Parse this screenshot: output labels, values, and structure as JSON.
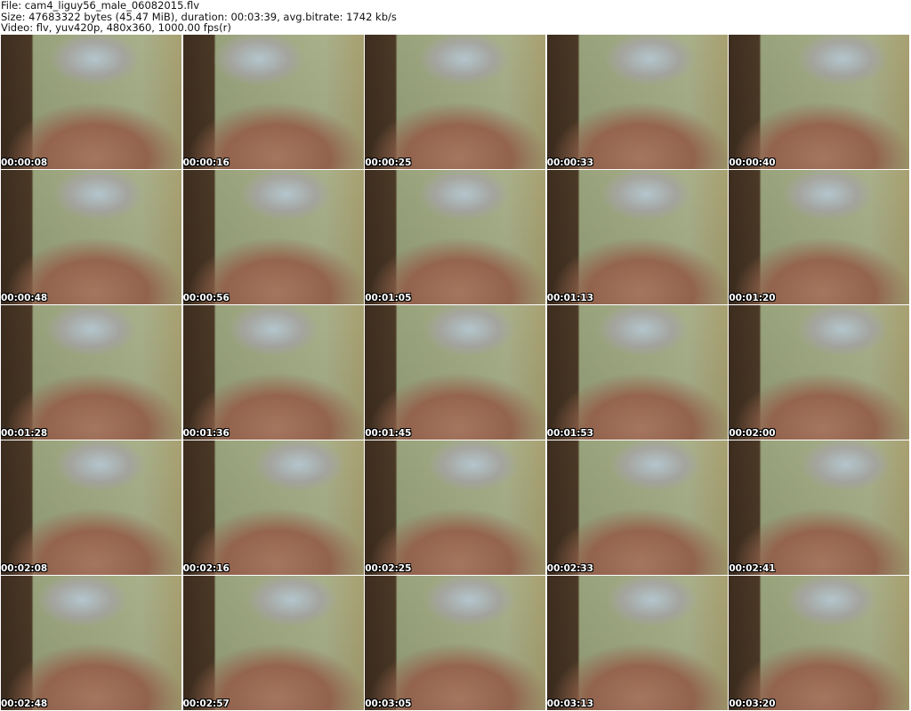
{
  "header": {
    "file_line": "File: cam4_liguy56_male_06082015.flv",
    "size_line": "Size: 47683322 bytes (45.47 MiB), duration: 00:03:39, avg.bitrate: 1742 kb/s",
    "video_line": "Video: flv, yuv420p, 480x360, 1000.00 fps(r)"
  },
  "thumbnails": [
    {
      "timestamp": "00:00:08"
    },
    {
      "timestamp": "00:00:16"
    },
    {
      "timestamp": "00:00:25"
    },
    {
      "timestamp": "00:00:33"
    },
    {
      "timestamp": "00:00:40"
    },
    {
      "timestamp": "00:00:48"
    },
    {
      "timestamp": "00:00:56"
    },
    {
      "timestamp": "00:01:05"
    },
    {
      "timestamp": "00:01:13"
    },
    {
      "timestamp": "00:01:20"
    },
    {
      "timestamp": "00:01:28"
    },
    {
      "timestamp": "00:01:36"
    },
    {
      "timestamp": "00:01:45"
    },
    {
      "timestamp": "00:01:53"
    },
    {
      "timestamp": "00:02:00"
    },
    {
      "timestamp": "00:02:08"
    },
    {
      "timestamp": "00:02:16"
    },
    {
      "timestamp": "00:02:25"
    },
    {
      "timestamp": "00:02:33"
    },
    {
      "timestamp": "00:02:41"
    },
    {
      "timestamp": "00:02:48"
    },
    {
      "timestamp": "00:02:57"
    },
    {
      "timestamp": "00:03:05"
    },
    {
      "timestamp": "00:03:13"
    },
    {
      "timestamp": "00:03:20"
    }
  ]
}
